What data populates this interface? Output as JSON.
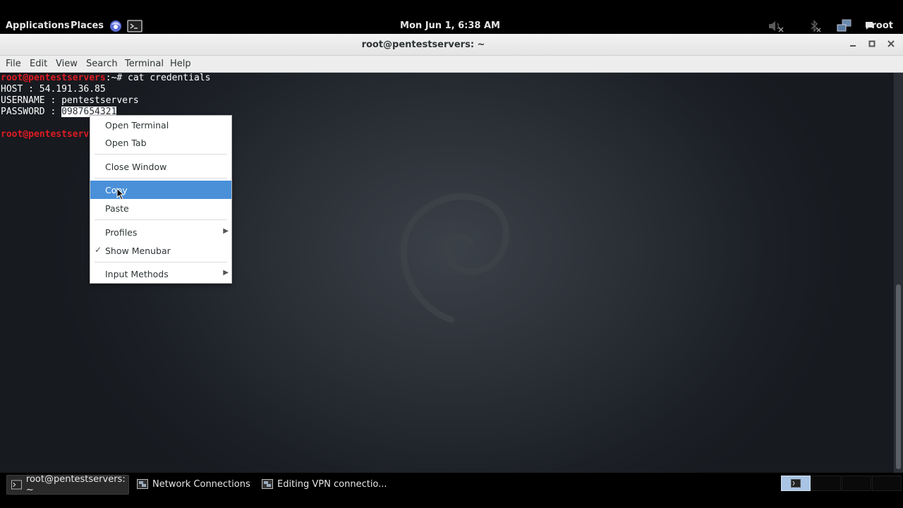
{
  "top_panel": {
    "applications_label": "Applications",
    "places_label": "Places",
    "clock": "Mon Jun  1,  6:38 AM",
    "user_label": "root"
  },
  "window": {
    "title": "root@pentestservers: ~"
  },
  "menubar": {
    "items": [
      "File",
      "Edit",
      "View",
      "Search",
      "Terminal",
      "Help"
    ]
  },
  "terminal": {
    "prompt_user": "root@pentestservers",
    "prompt_suffix": ":~# ",
    "command": "cat credentials",
    "lines": {
      "host": "HOST : 54.191.36.85",
      "username": "USERNAME : pentestservers",
      "password_label": "PASSWORD : ",
      "password_value": "0987654321"
    },
    "second_prompt_visible": "root@pentestserv"
  },
  "context_menu": {
    "open_terminal": "Open Terminal",
    "open_tab": "Open Tab",
    "close_window": "Close Window",
    "copy": "Copy",
    "paste": "Paste",
    "profiles": "Profiles",
    "show_menubar": "Show Menubar",
    "input_methods": "Input Methods"
  },
  "taskbar": {
    "tasks": [
      {
        "label": "root@pentestservers: ~",
        "active": true
      },
      {
        "label": "Network Connections",
        "active": false
      },
      {
        "label": "Editing VPN connectio...",
        "active": false
      }
    ]
  },
  "colors": {
    "menu_highlight": "#4a90d9",
    "prompt_red": "#e01b24",
    "prompt_blue": "#6d9fd9"
  },
  "icons": [
    "web-browser-icon",
    "terminal-launcher-icon",
    "volume-muted-icon",
    "bluetooth-icon",
    "network-icon",
    "chat-icon",
    "minimize-icon",
    "maximize-icon",
    "close-icon",
    "checkmark-icon",
    "submenu-arrow-icon",
    "mouse-pointer-icon"
  ]
}
